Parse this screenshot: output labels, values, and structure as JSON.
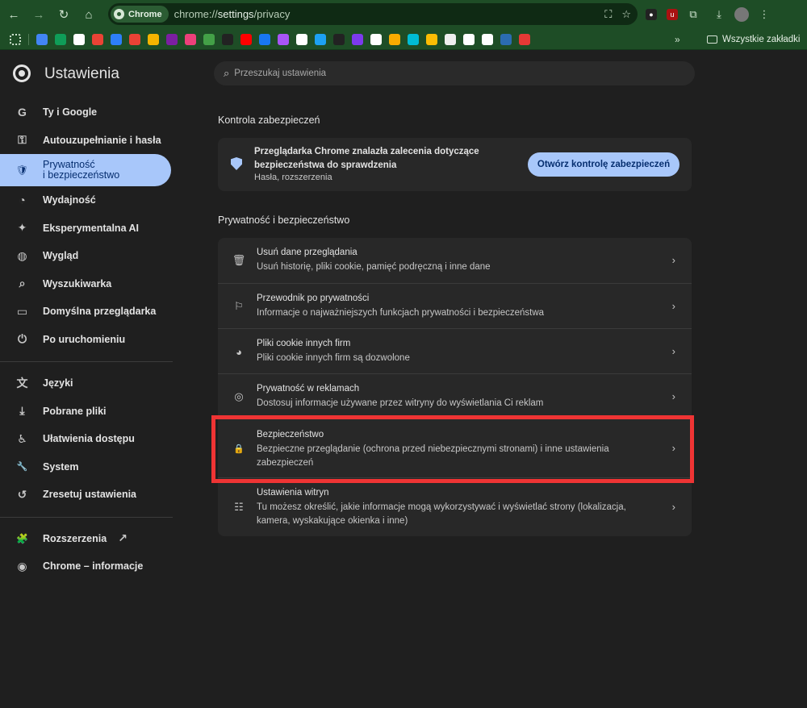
{
  "browser": {
    "chip_label": "Chrome",
    "url_prefix": "chrome://",
    "url_main": "settings",
    "url_suffix": "/privacy"
  },
  "bookmarks": {
    "more_label": "»",
    "folder_label": "Wszystkie zakładki",
    "colors": [
      "#4285f4",
      "#0f9d58",
      "#ffffff",
      "#ea4335",
      "#2d7ff9",
      "#e94235",
      "#f4b400",
      "#7b1fa2",
      "#ec407a",
      "#43a047",
      "#222222",
      "#ff0000",
      "#1877f2",
      "#a855f7",
      "#ffffff",
      "#1da1f2",
      "#222222",
      "#7c3aed",
      "#ffffff",
      "#f9ab00",
      "#00bcd4",
      "#fbbc04",
      "#eeeeee",
      "#ffffff",
      "#ffffff",
      "#2b6cb0",
      "#e53935"
    ]
  },
  "app": {
    "title": "Ustawienia"
  },
  "sidebar": {
    "items": [
      {
        "label": "Ty i Google",
        "icon": "G"
      },
      {
        "label": "Autouzupełnianie i hasła",
        "icon": "⚿"
      },
      {
        "label_line1": "Prywatność",
        "label_line2": "i bezpieczeństwo",
        "icon": "🛡"
      },
      {
        "label": "Wydajność",
        "icon": "◔"
      },
      {
        "label": "Eksperymentalna AI",
        "icon": "✦"
      },
      {
        "label": "Wygląd",
        "icon": "◍"
      },
      {
        "label": "Wyszukiwarka",
        "icon": "⌕"
      },
      {
        "label": "Domyślna przeglądarka",
        "icon": "▭"
      },
      {
        "label": "Po uruchomieniu",
        "icon": "⏻"
      },
      {
        "label": "Języki",
        "icon": "文"
      },
      {
        "label": "Pobrane pliki",
        "icon": "⤓"
      },
      {
        "label": "Ułatwienia dostępu",
        "icon": "♿"
      },
      {
        "label": "System",
        "icon": "🔧"
      },
      {
        "label": "Zresetuj ustawienia",
        "icon": "↺"
      },
      {
        "label": "Rozszerzenia",
        "icon": "🧩"
      },
      {
        "label": "Chrome – informacje",
        "icon": "◉"
      }
    ]
  },
  "search": {
    "placeholder": "Przeszukaj ustawienia"
  },
  "safety_check": {
    "section_title": "Kontrola zabezpieczeń",
    "text": "Przeglądarka Chrome znalazła zalecenia dotyczące bezpieczeństwa do sprawdzenia",
    "sub": "Hasła, rozszerzenia",
    "button": "Otwórz kontrolę zabezpieczeń"
  },
  "privacy": {
    "section_title": "Prywatność i bezpieczeństwo",
    "rows": [
      {
        "title": "Usuń dane przeglądania",
        "desc": "Usuń historię, pliki cookie, pamięć podręczną i inne dane",
        "icon": "🗑"
      },
      {
        "title": "Przewodnik po prywatności",
        "desc": "Informacje o najważniejszych funkcjach prywatności i bezpieczeństwa",
        "icon": "⚐"
      },
      {
        "title": "Pliki cookie innych firm",
        "desc": "Pliki cookie innych firm są dozwolone",
        "icon": "◕"
      },
      {
        "title": "Prywatność w reklamach",
        "desc": "Dostosuj informacje używane przez witryny do wyświetlania Ci reklam",
        "icon": "◎"
      },
      {
        "title": "Bezpieczeństwo",
        "desc": "Bezpieczne przeglądanie (ochrona przed niebezpiecznymi stronami) i inne ustawienia zabezpieczeń",
        "icon": "🔒"
      },
      {
        "title": "Ustawienia witryn",
        "desc": "Tu możesz określić, jakie informacje mogą wykorzystywać i wyświetlać strony (lokalizacja, kamera, wyskakujące okienka i inne)",
        "icon": "☷"
      }
    ],
    "chevron": "›"
  },
  "colors": {
    "highlight": "#ef3434",
    "accent": "#a8c7fa"
  }
}
